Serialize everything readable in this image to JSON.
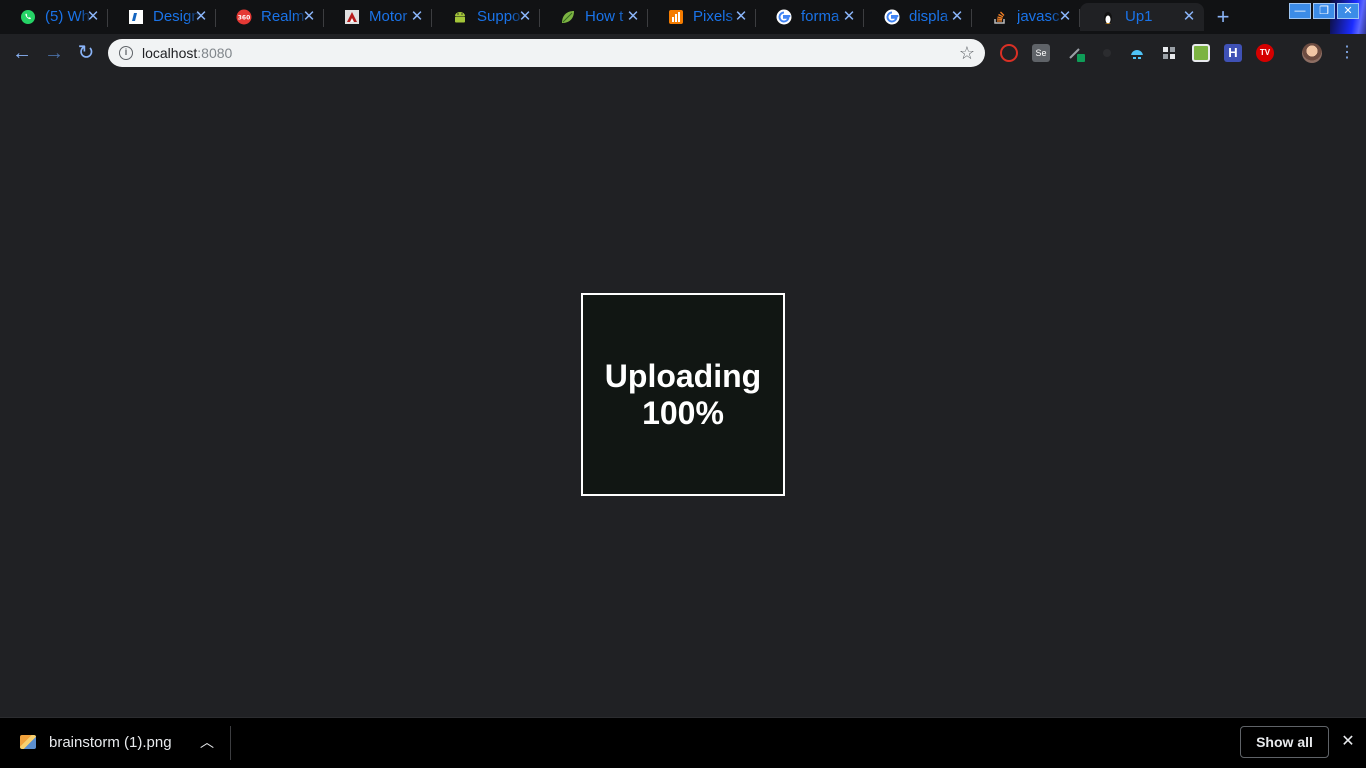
{
  "tabs": [
    {
      "title": "(5) Wh",
      "favicon": "whatsapp-icon"
    },
    {
      "title": "Design",
      "favicon": "design-icon"
    },
    {
      "title": "Realm",
      "favicon": "360-icon"
    },
    {
      "title": "Motor",
      "favicon": "motor-icon"
    },
    {
      "title": "Suppo",
      "favicon": "android-icon"
    },
    {
      "title": "How t",
      "favicon": "leaf-icon"
    },
    {
      "title": "Pixels",
      "favicon": "pixels-icon"
    },
    {
      "title": "forma",
      "favicon": "google-icon"
    },
    {
      "title": "displa",
      "favicon": "google-icon"
    },
    {
      "title": "javasc",
      "favicon": "stackoverflow-icon"
    },
    {
      "title": "Up1",
      "favicon": "linux-icon",
      "active": true
    }
  ],
  "address_bar": {
    "host": "localhost",
    "port": ":8080"
  },
  "page": {
    "upload_line1": "Uploading",
    "upload_line2": "100%"
  },
  "download_bar": {
    "filename": "brainstorm (1).png",
    "show_all_label": "Show all"
  },
  "colors": {
    "page_background": "#202124",
    "tab_title": "#1a73e8",
    "upload_box": "#111613"
  }
}
